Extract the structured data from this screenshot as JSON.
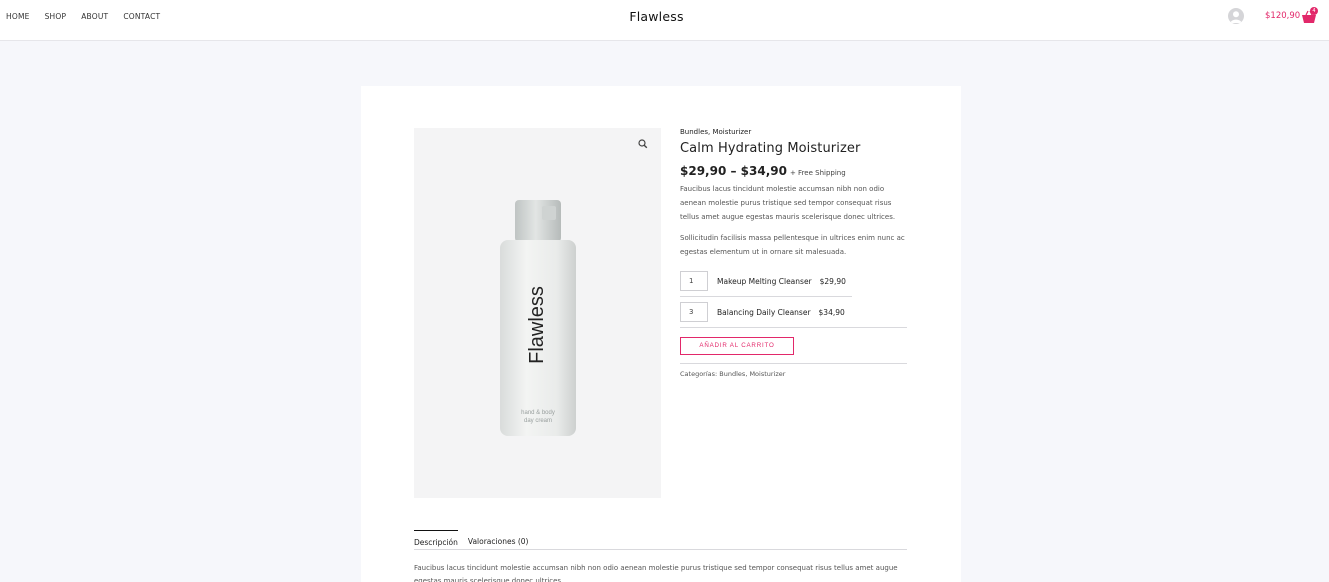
{
  "nav": {
    "items": [
      {
        "label": "HOME"
      },
      {
        "label": "SHOP"
      },
      {
        "label": "ABOUT"
      },
      {
        "label": "CONTACT"
      }
    ]
  },
  "header": {
    "logo": "Flawless",
    "cart_total": "$120,90",
    "cart_count": "4"
  },
  "colors": {
    "accent": "#e2286a"
  },
  "product": {
    "categories_top": "Bundles, Moisturizer",
    "title": "Calm Hydrating Moisturizer",
    "price_range": "$29,90 – $34,90",
    "shipping": "+ Free Shipping",
    "description_1": "Faucibus lacus tincidunt molestie accumsan nibh non odio aenean molestie purus tristique sed tempor consequat risus tellus amet augue egestas mauris scelerisque donec ultrices.",
    "description_2": "Sollicitudin facilisis massa pellentesque in ultrices enim nunc ac egestas elementum ut in ornare sit malesuada.",
    "bottle_brand": "Flawless",
    "bottle_subtext_1": "hand & body",
    "bottle_subtext_2": "day cream",
    "bundle": [
      {
        "qty": "1",
        "name": "Makeup Melting Cleanser",
        "price": "$29,90"
      },
      {
        "qty": "3",
        "name": "Balancing Daily Cleanser",
        "price": "$34,90"
      }
    ],
    "add_to_cart": "AÑADIR AL CARRITO",
    "categories_label": "Categorías:",
    "categories_value": "Bundles, Moisturizer"
  },
  "tabs": {
    "description": "Descripción",
    "reviews": "Valoraciones (0)",
    "body": "Faucibus lacus tincidunt molestie accumsan nibh non odio aenean molestie purus tristique sed tempor consequat risus tellus amet augue egestas mauris scelerisque donec ultrices."
  },
  "icons": {
    "zoom": "magnifier-icon",
    "account": "user-avatar-icon",
    "cart": "shopping-basket-icon"
  }
}
